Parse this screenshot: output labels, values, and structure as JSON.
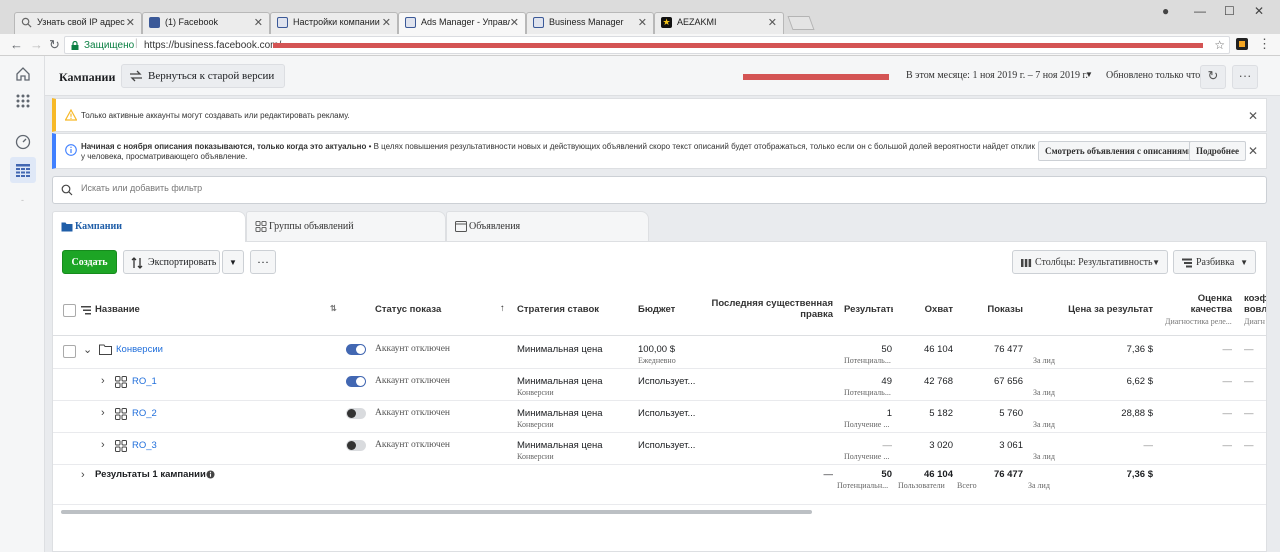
{
  "browser": {
    "tabs": [
      {
        "label": "Узнать свой IP адрес"
      },
      {
        "label": "(1) Facebook"
      },
      {
        "label": "Настройки компании"
      },
      {
        "label": "Ads Manager - Управлен"
      },
      {
        "label": "Business Manager"
      },
      {
        "label": "AEZAKMI"
      }
    ],
    "secure_label": "Защищено",
    "url": "https://business.facebook.com/"
  },
  "header": {
    "title": "Кампании",
    "old_version_label": "Вернуться к старой версии",
    "date_range": "В этом месяце: 1 ноя 2019 г. – 7 ноя 2019 г.",
    "updated_label": "Обновлено только что",
    "more_label": "···"
  },
  "notices": {
    "warning_text": "Только активные аккаунты могут создавать или редактировать рекламу.",
    "info_bold": "Начиная с ноября описания показываются, только когда это актуально",
    "info_text": " • В целях повышения результативности новых и действующих объявлений скоро текст описаний будет отображаться, только если он с большой долей вероятности найдет отклик у человека, просматривающего объявление.",
    "view_ads_label": "Смотреть объявления с описаниями",
    "more_info_label": "Подробнее"
  },
  "search": {
    "placeholder": "Искать или добавить фильтр"
  },
  "entity_tabs": {
    "campaigns": "Кампании",
    "adsets": "Группы объявлений",
    "ads": "Объявления"
  },
  "toolbar": {
    "create_label": "Создать",
    "export_label": "Экспортировать",
    "more_label": "···",
    "columns_label": "Столбцы: Результативность",
    "breakdown_label": "Разбивка"
  },
  "columns": {
    "name": "Название",
    "status": "Статус показа",
    "strategy": "Стратегия ставок",
    "budget": "Бюджет",
    "last_change": "Последняя существенная правка",
    "results": "Результаты",
    "reach": "Охват",
    "impressions": "Показы",
    "cost": "Цена за результат",
    "quality": "Оценка качества",
    "quality_sub": "Диагностика реле...",
    "engagement": "коэф вовл",
    "engagement_sub": "Диагн"
  },
  "rows": [
    {
      "name": "Конверсии",
      "status": "Аккаунт отключен",
      "toggle_on": true,
      "strategy": "Минимальная цена",
      "strategy_sub": "",
      "budget": "100,00 $",
      "budget_sub": "Ежедневно",
      "results": "50",
      "results_sub": "Потенциаль...",
      "reach": "46 104",
      "impressions": "76 477",
      "cost": "7,36 $",
      "cost_sub": "За лид",
      "quality": "—",
      "engagement": "—"
    },
    {
      "name": "RO_1",
      "status": "Аккаунт отключен",
      "toggle_on": true,
      "strategy": "Минимальная цена",
      "strategy_sub": "Конверсии",
      "budget": "Использует...",
      "budget_sub": "",
      "results": "49",
      "results_sub": "Потенциаль...",
      "reach": "42 768",
      "impressions": "67 656",
      "cost": "6,62 $",
      "cost_sub": "За лид",
      "quality": "—",
      "engagement": "—"
    },
    {
      "name": "RO_2",
      "status": "Аккаунт отключен",
      "toggle_on": false,
      "strategy": "Минимальная цена",
      "strategy_sub": "Конверсии",
      "budget": "Использует...",
      "budget_sub": "",
      "results": "1",
      "results_sub": "Получение ...",
      "reach": "5 182",
      "impressions": "5 760",
      "cost": "28,88 $",
      "cost_sub": "За лид",
      "quality": "—",
      "engagement": "—"
    },
    {
      "name": "RO_3",
      "status": "Аккаунт отключен",
      "toggle_on": false,
      "strategy": "Минимальная цена",
      "strategy_sub": "Конверсии",
      "budget": "Использует...",
      "budget_sub": "",
      "results": "—",
      "results_sub": "Получение ...",
      "reach": "3 020",
      "impressions": "3 061",
      "cost": "—",
      "cost_sub": "За лид",
      "quality": "—",
      "engagement": "—"
    }
  ],
  "totals": {
    "label": "Результаты 1 кампании",
    "last_change": "—",
    "results": "50",
    "results_sub": "Потенциальн...",
    "reach": "46 104",
    "reach_sub": "Пользователи",
    "impressions": "76 477",
    "impressions_sub": "Всего",
    "cost": "7,36 $",
    "cost_sub": "За лид"
  },
  "colors": {
    "create_green": "#1da525",
    "link_blue": "#216fdb",
    "toggle_blue": "#4267b2",
    "warning_yellow": "#f7b928",
    "info_blue": "#4080ff"
  }
}
